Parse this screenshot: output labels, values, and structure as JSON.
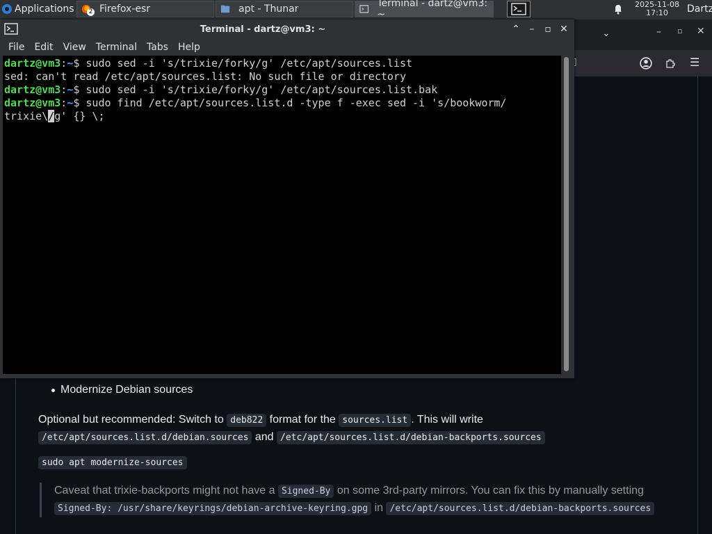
{
  "panel": {
    "applications_label": "Applications",
    "tasks": [
      {
        "label": "Firefox-esr",
        "badge": "2"
      },
      {
        "label": "apt - Thunar"
      },
      {
        "label": "Terminal - dartz@vm3: ~"
      }
    ],
    "clock_date": "2025-11-08",
    "clock_time": "17:10",
    "user": "Dartz"
  },
  "terminal": {
    "title": "Terminal - dartz@vm3: ~",
    "menu": [
      "File",
      "Edit",
      "View",
      "Terminal",
      "Tabs",
      "Help"
    ],
    "prompt_user": "dartz@vm3",
    "prompt_sep": ":~$ ",
    "lines": [
      {
        "type": "prompt",
        "cmd": "sudo sed -i 's/trixie/forky/g' /etc/apt/sources.list"
      },
      {
        "type": "output",
        "text": "sed: can't read /etc/apt/sources.list: No such file or directory"
      },
      {
        "type": "prompt",
        "cmd": "sudo sed -i 's/trixie/forky/g' /etc/apt/sources.list.bak"
      },
      {
        "type": "prompt",
        "cmd": "sudo find /etc/apt/sources.list.d -type f -exec sed -i 's/bookworm/"
      }
    ],
    "wrap_before_cursor": "trixie\\",
    "cursor_char": "/",
    "wrap_after_cursor": "g' {} \\;"
  },
  "doc": {
    "list_item": "Modernize Debian sources",
    "p1_a": "Optional but recommended: Switch to ",
    "p1_code1": "deb822",
    "p1_b": " format for the ",
    "p1_code2": "sources.list",
    "p1_c": ". This will write ",
    "p1_code3": "/etc/apt/sources.list.d/debian.sources",
    "p1_d": " and ",
    "p1_code4": "/etc/apt/sources.list.d/debian-backports.sources",
    "cmd": "sudo apt modernize-sources",
    "quote_a": "Caveat that trixie-backports might not have a ",
    "quote_code1": "Signed-By",
    "quote_b": " on some 3rd-party mirrors. You can fix this by manually setting ",
    "quote_code2": "Signed-By: /usr/share/keyrings/debian-archive-keyring.gpg",
    "quote_c": " in ",
    "quote_code3": "/etc/apt/sources.list.d/debian-backports.sources"
  }
}
